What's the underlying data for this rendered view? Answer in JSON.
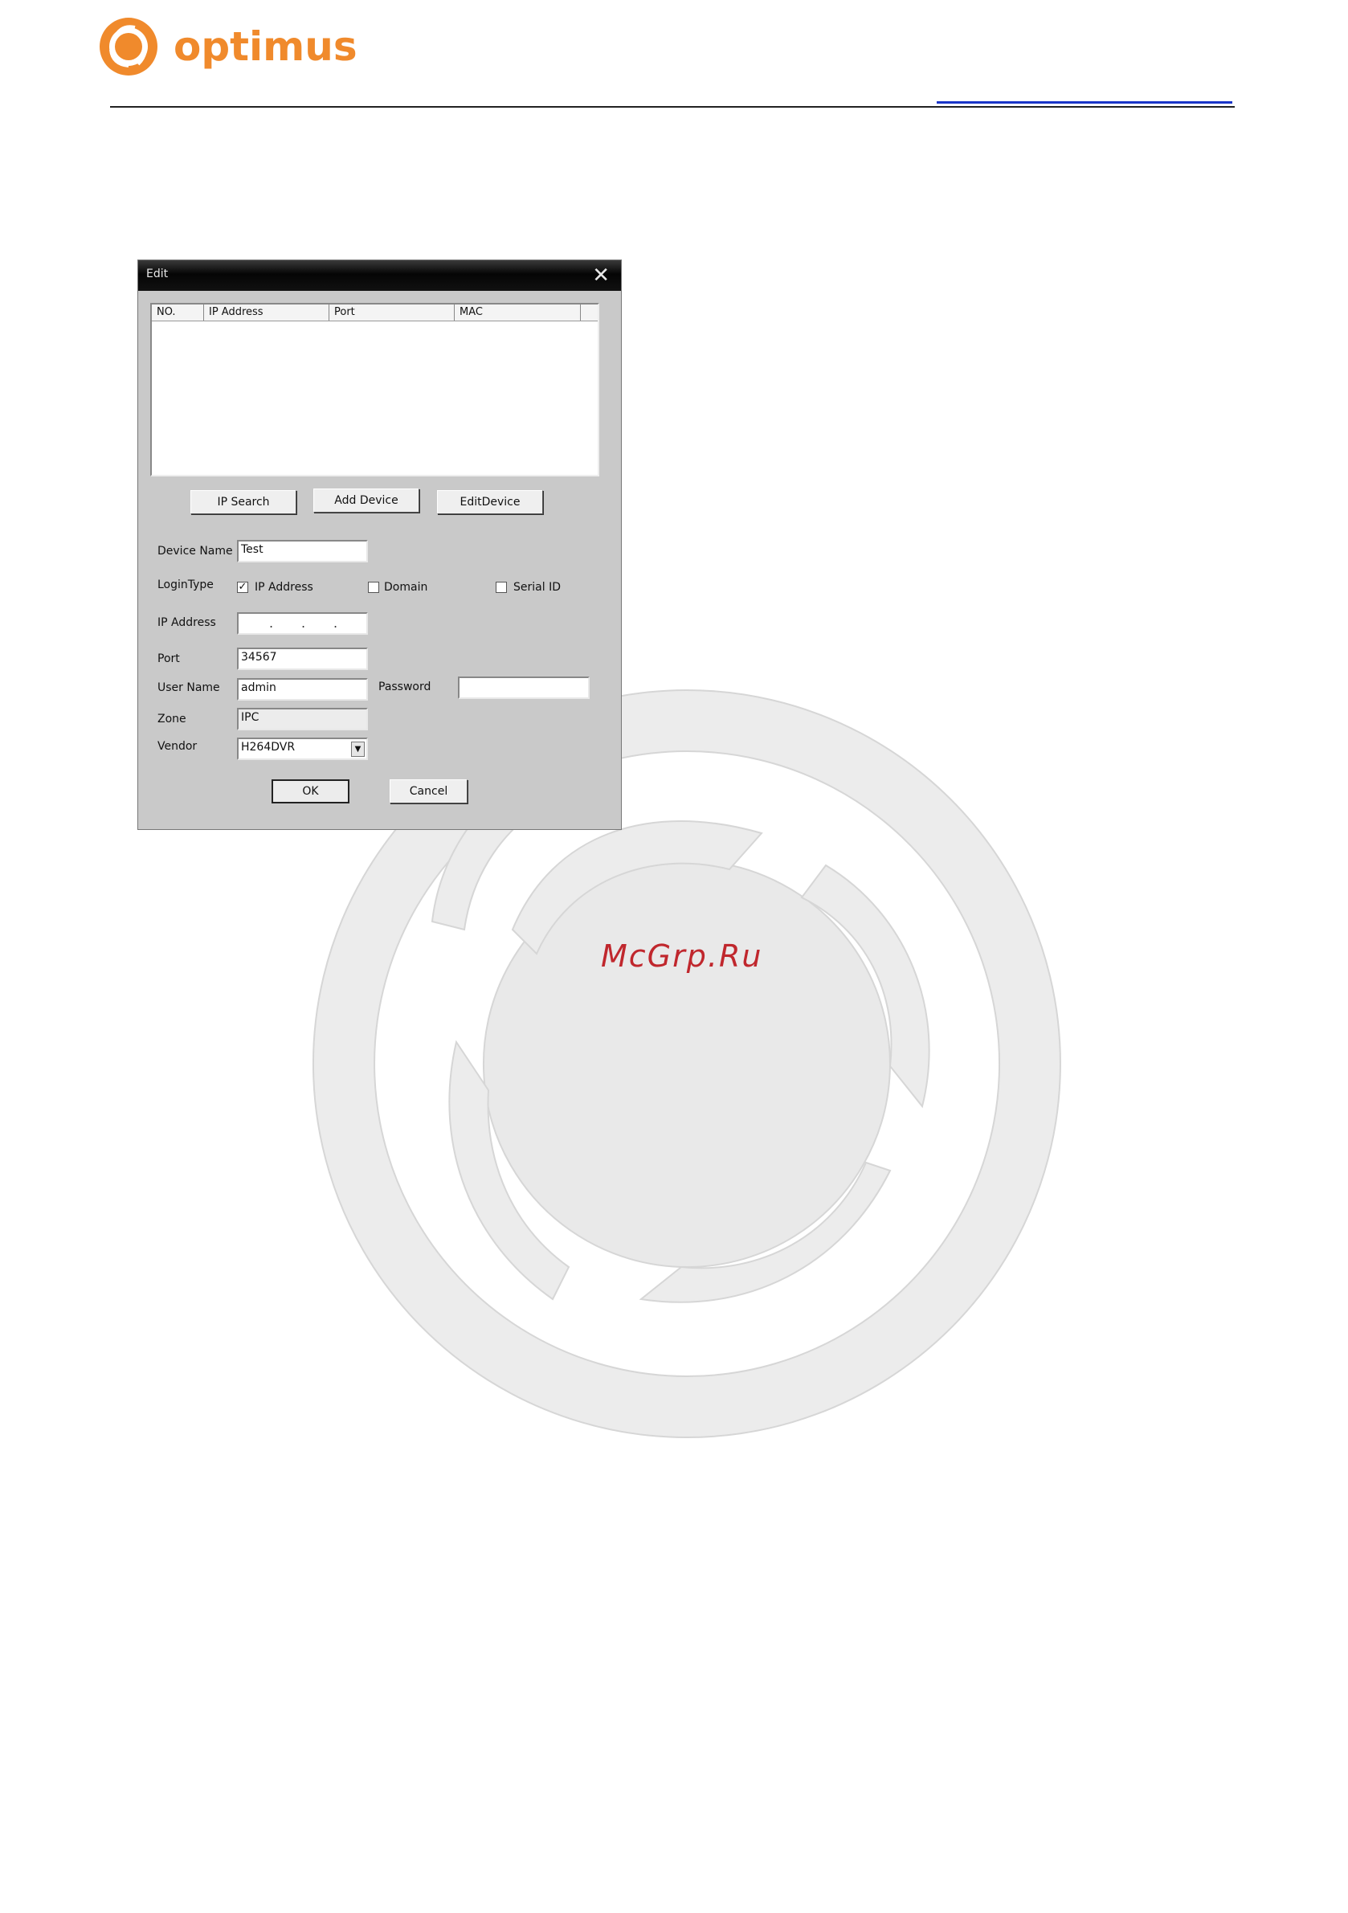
{
  "brand": {
    "name": "optimus",
    "color": "#f08a2c"
  },
  "watermark": {
    "text": "McGrp.Ru",
    "text_color": "#c0272d"
  },
  "dialog": {
    "title": "Edit",
    "close_icon": "close-icon",
    "device_list": {
      "columns": [
        "NO.",
        "IP Address",
        "Port",
        "MAC"
      ],
      "rows": []
    },
    "buttons": {
      "ip_search": "IP Search",
      "add_device": "Add Device",
      "edit_device": "EditDevice",
      "ok": "OK",
      "cancel": "Cancel"
    },
    "form": {
      "device_name_label": "Device Name",
      "device_name_value": "Test",
      "login_type_label": "LoginType",
      "login_type_options": [
        {
          "label": "IP Address",
          "checked": true
        },
        {
          "label": "Domain",
          "checked": false
        },
        {
          "label": "Serial ID",
          "checked": false
        }
      ],
      "ip_address_label": "IP Address",
      "ip_address_value": "",
      "port_label": "Port",
      "port_value": "34567",
      "user_name_label": "User Name",
      "user_name_value": "admin",
      "password_label": "Password",
      "password_value": "",
      "zone_label": "Zone",
      "zone_value": "IPC",
      "vendor_label": "Vendor",
      "vendor_value": "H264DVR"
    }
  }
}
